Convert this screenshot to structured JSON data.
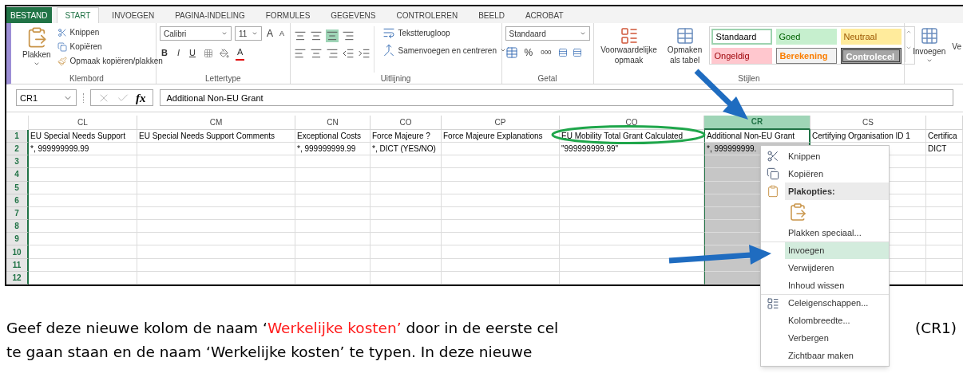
{
  "tabs": [
    {
      "label": "BESTAND",
      "kind": "file",
      "selected": false
    },
    {
      "label": "START",
      "kind": "tab",
      "selected": true
    },
    {
      "label": "INVOEGEN",
      "kind": "tab",
      "selected": false
    },
    {
      "label": "PAGINA-INDELING",
      "kind": "tab",
      "selected": false
    },
    {
      "label": "FORMULES",
      "kind": "tab",
      "selected": false
    },
    {
      "label": "GEGEVENS",
      "kind": "tab",
      "selected": false
    },
    {
      "label": "CONTROLEREN",
      "kind": "tab",
      "selected": false
    },
    {
      "label": "BEELD",
      "kind": "tab",
      "selected": false
    },
    {
      "label": "ACROBAT",
      "kind": "tab",
      "selected": false
    }
  ],
  "ribbon": {
    "clipboard": {
      "paste": "Plakken",
      "cut": "Knippen",
      "copy": "Kopiëren",
      "format_painter": "Opmaak kopiëren/plakken",
      "label": "Klembord"
    },
    "font": {
      "name": "Calibri",
      "size": "11",
      "grow": "A",
      "shrink": "A",
      "bold": "B",
      "italic": "I",
      "underline": "U",
      "font_color": "A",
      "label": "Lettertype"
    },
    "alignment": {
      "wrap": "Tekstterugloop",
      "merge": "Samenvoegen en centreren",
      "label": "Uitlijning"
    },
    "number": {
      "format": "Standaard",
      "percent": "%",
      "thousands": "000",
      "label": "Getal"
    },
    "styles": {
      "conditional": "Voorwaardelijke opmaak",
      "as_table": "Opmaken als tabel",
      "label": "Stijlen",
      "cells": [
        {
          "label": "Standaard",
          "kind": "normal"
        },
        {
          "label": "Goed",
          "kind": "good"
        },
        {
          "label": "Neutraal",
          "kind": "neutral"
        },
        {
          "label": "Ongeldig",
          "kind": "bad"
        },
        {
          "label": "Berekening",
          "kind": "calculation"
        },
        {
          "label": "Controlecel",
          "kind": "check"
        }
      ]
    },
    "cells": {
      "insert": "Invoegen",
      "item_2": "Ve"
    }
  },
  "formula_bar": {
    "name_box": "CR1",
    "fx": "fx",
    "value": "Additional Non-EU Grant"
  },
  "sheet": {
    "columns": [
      {
        "label": "CL",
        "selected": false
      },
      {
        "label": "CM",
        "selected": false
      },
      {
        "label": "CN",
        "selected": false
      },
      {
        "label": "CO",
        "selected": false
      },
      {
        "label": "CP",
        "selected": false
      },
      {
        "label": "CQ",
        "selected": false
      },
      {
        "label": "CR",
        "selected": true
      },
      {
        "label": "CS",
        "selected": false
      },
      {
        "selected": false
      }
    ],
    "rows": [
      {
        "label": "1",
        "cells": [
          "EU Special Needs Support",
          "EU Special Needs Support Comments",
          "Exceptional Costs",
          "Force Majeure ?",
          "Force Majeure Explanations",
          "EU Mobility Total Grant Calculated",
          "Additional Non-EU Grant",
          "Certifying Organisation ID 1",
          "Certifica"
        ]
      },
      {
        "label": "2",
        "cells": [
          "*, 999999999.99",
          null,
          "*, 999999999.99",
          "*, DICT (YES/NO)",
          null,
          "\"999999999.99\"",
          "*, 999999999.",
          null,
          "DICT"
        ]
      },
      {
        "label": "3",
        "cells": []
      },
      {
        "label": "4",
        "cells": []
      },
      {
        "label": "5",
        "cells": []
      },
      {
        "label": "6",
        "cells": []
      },
      {
        "label": "7",
        "cells": []
      },
      {
        "label": "8",
        "cells": []
      },
      {
        "label": "9",
        "cells": []
      },
      {
        "label": "10",
        "cells": []
      },
      {
        "label": "11",
        "cells": []
      },
      {
        "label": "12",
        "cells": []
      }
    ]
  },
  "context_menu": [
    {
      "kind": "item",
      "label": "Knippen",
      "selected": false
    },
    {
      "kind": "item",
      "label": "Kopiëren",
      "selected": false
    },
    {
      "kind": "header",
      "label": "Plakopties:",
      "selected": false
    },
    {
      "kind": "paste-option",
      "selected": false
    },
    {
      "kind": "item",
      "label": "Plakken speciaal...",
      "selected": false
    },
    {
      "kind": "item",
      "label": "Invoegen",
      "selected": true
    },
    {
      "kind": "item",
      "label": "Verwijderen",
      "selected": false
    },
    {
      "kind": "item",
      "label": "Inhoud wissen",
      "selected": false
    },
    {
      "kind": "item",
      "label": "Celeigenschappen...",
      "selected": false
    },
    {
      "kind": "item",
      "label": "Kolombreedte...",
      "selected": false
    },
    {
      "kind": "item",
      "label": "Verbergen",
      "selected": false
    },
    {
      "kind": "item",
      "label": "Zichtbaar maken",
      "selected": false
    }
  ],
  "paragraph": {
    "segments": [
      {
        "text": "Geef deze nieuwe kolom de naam ‘",
        "highlight": false
      },
      {
        "text": "Werkelijke kosten’",
        "highlight": true
      },
      {
        "text": " door in de eerste cel",
        "highlight": false
      }
    ],
    "aside": "(CR1)",
    "line_2": "te gaan staan en de naam ‘Werkelijke kosten’ te typen. In deze nieuwe"
  }
}
